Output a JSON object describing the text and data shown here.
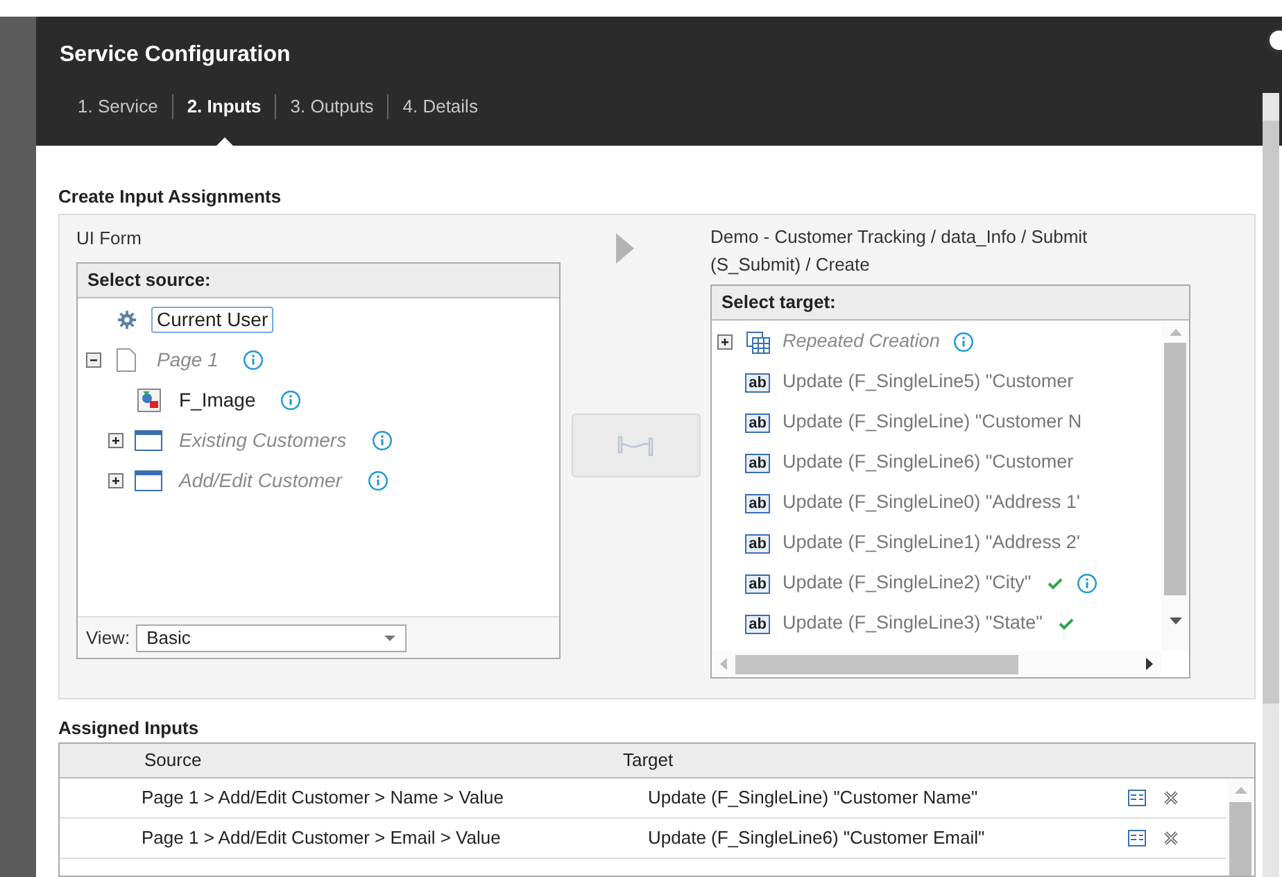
{
  "dialog": {
    "title": "Service Configuration"
  },
  "tabs": [
    {
      "label": "1. Service",
      "selected": false
    },
    {
      "label": "2. Inputs",
      "selected": true
    },
    {
      "label": "3. Outputs",
      "selected": false
    },
    {
      "label": "4. Details",
      "selected": false
    }
  ],
  "section_title": "Create Input Assignments",
  "source": {
    "title": "UI Form",
    "header": "Select source:",
    "view_label": "View:",
    "view_value": "Basic",
    "tree": [
      {
        "label": "Current User",
        "kind": "user",
        "selected": true,
        "info": false
      },
      {
        "label": "Page 1",
        "kind": "page",
        "selected": false,
        "info": true,
        "expanded": true,
        "children": [
          {
            "label": "F_Image",
            "kind": "image",
            "selected": false,
            "info": true
          },
          {
            "label": "Existing Customers",
            "kind": "section",
            "selected": false,
            "info": true,
            "expanded": false
          },
          {
            "label": "Add/Edit Customer",
            "kind": "section",
            "selected": false,
            "info": true,
            "expanded": false
          }
        ]
      }
    ]
  },
  "target": {
    "title": "Demo - Customer Tracking / data_Info / Submit (S_Submit) / Create",
    "header": "Select target:",
    "items": [
      {
        "label": "Repeated Creation",
        "kind": "repeat",
        "info": true,
        "checked": false,
        "expanded": false
      },
      {
        "label": "Update (F_SingleLine5) \"Customer",
        "kind": "text",
        "icon_label": "ab",
        "info": false,
        "checked": false
      },
      {
        "label": "Update (F_SingleLine) \"Customer N",
        "kind": "text",
        "icon_label": "ab",
        "info": false,
        "checked": false
      },
      {
        "label": "Update (F_SingleLine6) \"Customer",
        "kind": "text",
        "icon_label": "ab",
        "info": false,
        "checked": false
      },
      {
        "label": "Update (F_SingleLine0) \"Address 1'",
        "kind": "text",
        "icon_label": "ab",
        "info": false,
        "checked": false
      },
      {
        "label": "Update (F_SingleLine1) \"Address 2'",
        "kind": "text",
        "icon_label": "ab",
        "info": false,
        "checked": false
      },
      {
        "label": "Update (F_SingleLine2) \"City\"",
        "kind": "text",
        "icon_label": "ab",
        "info": true,
        "checked": true
      },
      {
        "label": "Update (F_SingleLine3) \"State\"",
        "kind": "text",
        "icon_label": "ab",
        "info": false,
        "checked": true
      }
    ]
  },
  "assigned": {
    "title": "Assigned Inputs",
    "columns": [
      "Source",
      "Target"
    ],
    "rows": [
      {
        "source": "Page 1 > Add/Edit Customer > Name > Value",
        "target": "Update (F_SingleLine) \"Customer Name\""
      },
      {
        "source": "Page 1 > Add/Edit Customer > Email > Value",
        "target": "Update (F_SingleLine6) \"Customer Email\""
      }
    ]
  }
}
